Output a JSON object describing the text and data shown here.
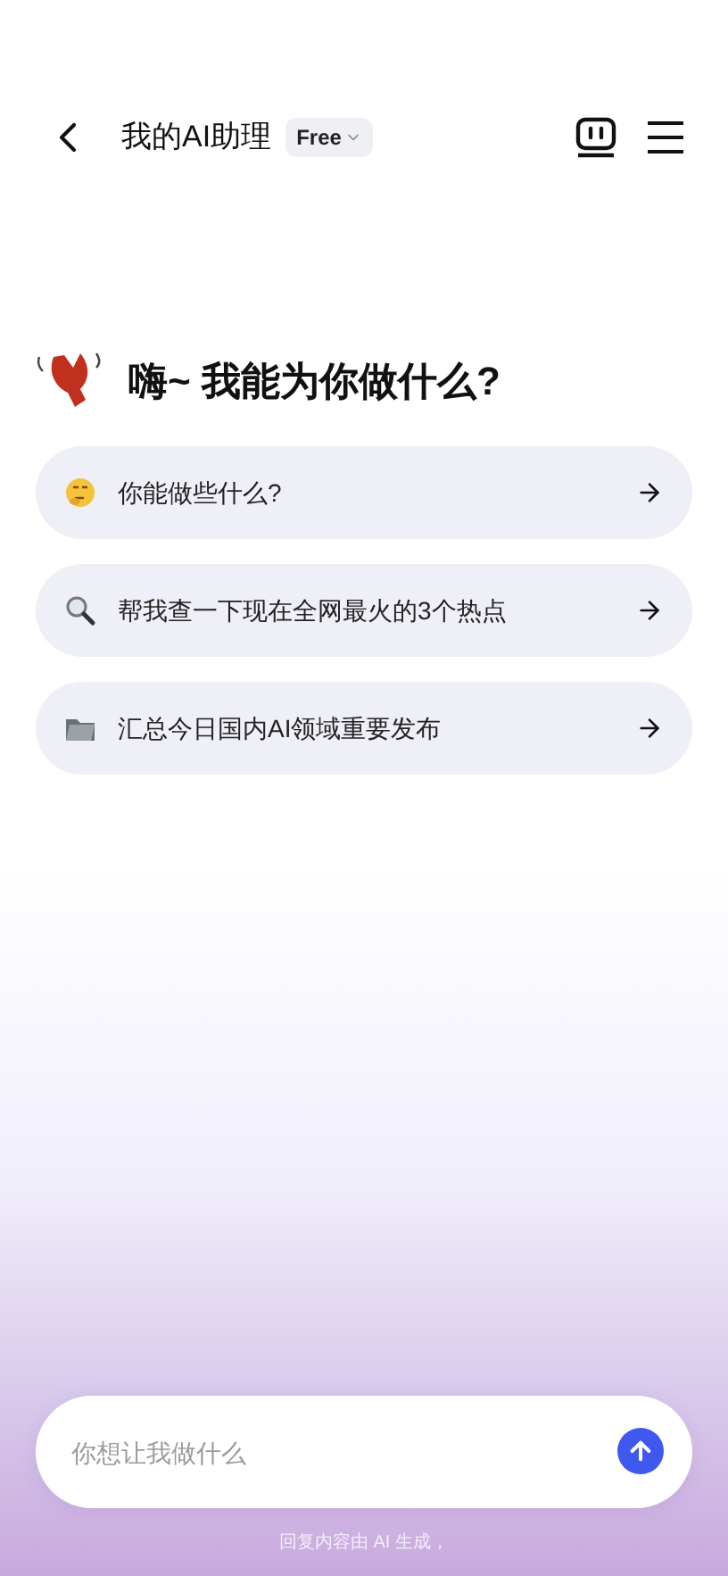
{
  "header": {
    "title": "我的AI助理",
    "plan_badge": "Free"
  },
  "greeting": "嗨~ 我能为你做什么?",
  "suggestions": [
    {
      "kind": "thinking",
      "text": "你能做些什么?"
    },
    {
      "kind": "search",
      "text": "帮我查一下现在全网最火的3个热点"
    },
    {
      "kind": "folder",
      "text": "汇总今日国内AI领域重要发布"
    }
  ],
  "input": {
    "placeholder": "你想让我做什么"
  },
  "disclaimer": "回复内容由 AI 生成，"
}
